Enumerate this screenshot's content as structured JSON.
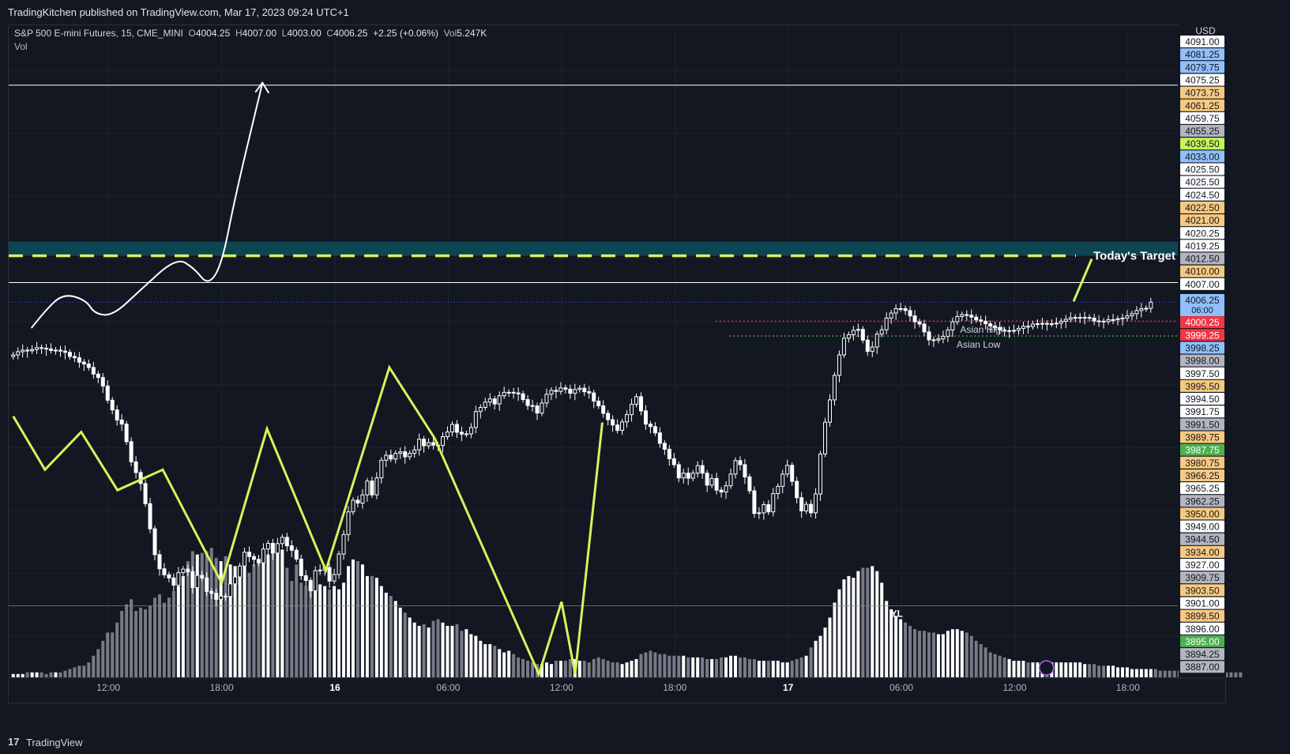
{
  "header": {
    "published": "TradingKitchen published on TradingView.com, Mar 17, 2023 09:24 UTC+1"
  },
  "legend": {
    "symbol": "S&P 500 E-mini Futures, 15, CME_MINI",
    "o_label": "O",
    "o": "4004.25",
    "h_label": "H",
    "h": "4007.00",
    "l_label": "L",
    "l": "4003.00",
    "c_label": "C",
    "c": "4006.25",
    "change": "+2.25 (+0.06%)",
    "vol_label": "Vol",
    "vol": "5.247K",
    "study": "Vol"
  },
  "footer": {
    "brand": "TradingView",
    "logo": "17"
  },
  "colors": {
    "background": "#131722",
    "candle": "#ffffff",
    "volume_up": "#ffffff",
    "volume_down": "#787b86",
    "target_line": "#d4f55a",
    "target_zone": "#0e4d5a",
    "path_yellow": "#d4f55a",
    "asian_high": "#f23645",
    "asian_low": "#4caf50",
    "yl": "#4caf50"
  },
  "chart_data": {
    "type": "candlestick",
    "currency": "USD",
    "ylim": [
      3887.0,
      4091.0
    ],
    "x_time_axis": [
      {
        "label": "12:00",
        "t": 0.5
      },
      {
        "label": "18:00",
        "t": 0.75
      },
      {
        "label": "16",
        "t": 1.0,
        "bold": true
      },
      {
        "label": "06:00",
        "t": 1.25
      },
      {
        "label": "12:00",
        "t": 1.5
      },
      {
        "label": "18:00",
        "t": 1.75
      },
      {
        "label": "17",
        "t": 2.0,
        "bold": true
      },
      {
        "label": "06:00",
        "t": 2.25
      },
      {
        "label": "12:00",
        "t": 2.5
      },
      {
        "label": "18:00",
        "t": 2.75
      }
    ],
    "xlim_days": [
      0.28,
      2.86
    ],
    "price_scale": [
      {
        "value": "4091.00",
        "bg": "#ffffff",
        "fg": "#131722",
        "partial": true
      },
      {
        "value": "4081.25",
        "bg": "#90bff9",
        "fg": "#131722"
      },
      {
        "value": "4079.75",
        "bg": "#90bff9",
        "fg": "#131722"
      },
      {
        "value": "4075.25",
        "bg": "#ffffff",
        "fg": "#131722"
      },
      {
        "value": "4073.75",
        "bg": "#f7c980",
        "fg": "#131722"
      },
      {
        "value": "4061.25",
        "bg": "#f7c980",
        "fg": "#131722"
      },
      {
        "value": "4059.75",
        "bg": "#ffffff",
        "fg": "#131722"
      },
      {
        "value": "4055.25",
        "bg": "#b2b5be",
        "fg": "#131722"
      },
      {
        "value": "4039.50",
        "bg": "#c1f655",
        "fg": "#131722"
      },
      {
        "value": "4033.00",
        "bg": "#90bff9",
        "fg": "#131722"
      },
      {
        "value": "4025.50",
        "bg": "#ffffff",
        "fg": "#131722"
      },
      {
        "value": "4025.50",
        "bg": "#ffffff",
        "fg": "#131722"
      },
      {
        "value": "4024.50",
        "bg": "#ffffff",
        "fg": "#131722"
      },
      {
        "value": "4022.50",
        "bg": "#f7c980",
        "fg": "#131722"
      },
      {
        "value": "4021.00",
        "bg": "#f7c980",
        "fg": "#131722"
      },
      {
        "value": "4020.25",
        "bg": "#ffffff",
        "fg": "#131722"
      },
      {
        "value": "4019.25",
        "bg": "#ffffff",
        "fg": "#131722"
      },
      {
        "value": "4012.50",
        "bg": "#b2b5be",
        "fg": "#131722"
      },
      {
        "value": "4010.00",
        "bg": "#f7c980",
        "fg": "#131722"
      },
      {
        "value": "4007.00",
        "bg": "#ffffff",
        "fg": "#131722"
      },
      {
        "value": "4006.25",
        "bg": "#90bff9",
        "fg": "#131722",
        "sub": "06:00",
        "tall": true
      },
      {
        "value": "4000.25",
        "bg": "#f23645",
        "fg": "#ffffff"
      },
      {
        "value": "3999.25",
        "bg": "#f23645",
        "fg": "#ffffff"
      },
      {
        "value": "3998.25",
        "bg": "#90bff9",
        "fg": "#131722"
      },
      {
        "value": "3998.00",
        "bg": "#b2b5be",
        "fg": "#131722"
      },
      {
        "value": "3997.50",
        "bg": "#ffffff",
        "fg": "#131722"
      },
      {
        "value": "3995.50",
        "bg": "#f7c980",
        "fg": "#131722"
      },
      {
        "value": "3994.50",
        "bg": "#ffffff",
        "fg": "#131722"
      },
      {
        "value": "3991.75",
        "bg": "#ffffff",
        "fg": "#131722"
      },
      {
        "value": "3991.50",
        "bg": "#b2b5be",
        "fg": "#131722"
      },
      {
        "value": "3989.75",
        "bg": "#f7c980",
        "fg": "#131722"
      },
      {
        "value": "3987.75",
        "bg": "#4caf50",
        "fg": "#ffffff"
      },
      {
        "value": "3980.75",
        "bg": "#f7c980",
        "fg": "#131722"
      },
      {
        "value": "3966.25",
        "bg": "#f7c980",
        "fg": "#131722"
      },
      {
        "value": "3965.25",
        "bg": "#ffffff",
        "fg": "#131722"
      },
      {
        "value": "3962.25",
        "bg": "#b2b5be",
        "fg": "#131722"
      },
      {
        "value": "3950.00",
        "bg": "#f7c980",
        "fg": "#131722"
      },
      {
        "value": "3949.00",
        "bg": "#ffffff",
        "fg": "#131722"
      },
      {
        "value": "3944.50",
        "bg": "#b2b5be",
        "fg": "#131722"
      },
      {
        "value": "3934.00",
        "bg": "#f7c980",
        "fg": "#131722"
      },
      {
        "value": "3927.00",
        "bg": "#ffffff",
        "fg": "#131722"
      },
      {
        "value": "3909.75",
        "bg": "#b2b5be",
        "fg": "#131722"
      },
      {
        "value": "3903.50",
        "bg": "#f7c980",
        "fg": "#131722"
      },
      {
        "value": "3901.00",
        "bg": "#ffffff",
        "fg": "#131722"
      },
      {
        "value": "3899.50",
        "bg": "#f7c980",
        "fg": "#131722"
      },
      {
        "value": "3896.00",
        "bg": "#ffffff",
        "fg": "#131722"
      },
      {
        "value": "3895.00",
        "bg": "#4caf50",
        "fg": "#ffffff"
      },
      {
        "value": "3894.25",
        "bg": "#b2b5be",
        "fg": "#131722"
      },
      {
        "value": "3887.00",
        "bg": "#b2b5be",
        "fg": "#131722"
      }
    ],
    "close_series": {
      "start_t": 0.29,
      "interval_days": 0.0104167,
      "closes": [
        3989.5,
        3990.5,
        3991.0,
        3990.8,
        3991.2,
        3991.8,
        3991.6,
        3991.4,
        3990.9,
        3991.0,
        3990.7,
        3990.3,
        3989.0,
        3988.6,
        3987.2,
        3986.6,
        3985.5,
        3983.4,
        3982.3,
        3979.6,
        3975.1,
        3972.0,
        3968.8,
        3967.5,
        3961.9,
        3955.5,
        3952.1,
        3948.6,
        3942.2,
        3934.2,
        3926.0,
        3921.5,
        3919.6,
        3918.6,
        3916.3,
        3920.3,
        3921.4,
        3920.6,
        3915.5,
        3919.4,
        3918.6,
        3914.3,
        3913.7,
        3911.8,
        3912.8,
        3912.7,
        3916.7,
        3918.9,
        3922.4,
        3926.8,
        3925.4,
        3924.5,
        3923.4,
        3927.8,
        3929.6,
        3926.5,
        3929.5,
        3931.5,
        3928.8,
        3927.4,
        3924.6,
        3919.3,
        3917.8,
        3914.5,
        3920.9,
        3921.1,
        3921.9,
        3917.6,
        3919.7,
        3926.2,
        3932.4,
        3939.6,
        3943.3,
        3942.4,
        3945.0,
        3949.4,
        3945.0,
        3950.4,
        3956.0,
        3957.6,
        3956.4,
        3958.2,
        3958.7,
        3957.1,
        3958.2,
        3959.3,
        3962.7,
        3960.6,
        3961.6,
        3960.8,
        3960.7,
        3963.5,
        3965.0,
        3967.4,
        3964.9,
        3964.3,
        3964.4,
        3966.4,
        3971.5,
        3972.8,
        3974.5,
        3975.5,
        3973.9,
        3976.5,
        3977.6,
        3977.6,
        3977.4,
        3977.1,
        3975.3,
        3973.4,
        3973.3,
        3971.0,
        3974.2,
        3977.0,
        3978.2,
        3977.9,
        3979.0,
        3978.6,
        3977.3,
        3978.5,
        3978.9,
        3977.8,
        3977.4,
        3974.8,
        3973.3,
        3970.9,
        3968.9,
        3967.2,
        3965.5,
        3968.2,
        3970.5,
        3973.8,
        3976.2,
        3971.7,
        3967.5,
        3966.7,
        3964.7,
        3961.4,
        3959.5,
        3956.5,
        3954.6,
        3950.4,
        3951.9,
        3950.3,
        3951.9,
        3954.3,
        3951.9,
        3948.1,
        3950.2,
        3946.5,
        3945.9,
        3947.9,
        3951.6,
        3955.9,
        3954.6,
        3950.7,
        3946.3,
        3939.1,
        3939.3,
        3941.9,
        3939.6,
        3945.4,
        3947.7,
        3951.6,
        3954.4,
        3949.3,
        3944.1,
        3939.9,
        3942.0,
        3939.3,
        3945.3,
        3958.0,
        3968.1,
        3975.2,
        3983.0,
        3989.5,
        3994.8,
        3995.9,
        3997.3,
        3997.6,
        3994.2,
        3990.6,
        3992.0,
        3996.1,
        3997.5,
        4001.2,
        4002.8,
        4004.2,
        4004.2,
        4003.6,
        4001.9,
        4000.0,
        3999.3,
        3996.8,
        3994.3,
        3994.2,
        3994.6,
        3995.4,
        3997.4,
        4000.0,
        4001.7,
        4002.3,
        4002.1,
        4001.5,
        4000.6,
        4000.2,
        3999.4,
        3998.7,
        3998.2,
        3997.4,
        3997.1,
        3997.2,
        3997.3,
        3997.9,
        3998.6,
        3998.5,
        3999.3,
        3999.4,
        3999.5,
        3999.4,
        3999.4,
        3999.6,
        4000.2,
        4000.8,
        4001.3,
        4001.4,
        4001.4,
        4001.4,
        4001.2,
        4000.3,
        4000.2,
        4000.1,
        4000.7,
        4000.7,
        4001.0,
        4001.2,
        4001.9,
        4002.6,
        4003.6,
        4004.2,
        4004.3,
        4006.25
      ]
    },
    "volume_series": [
      2,
      2,
      2,
      3,
      3,
      3,
      3,
      2,
      3,
      3,
      3,
      4,
      5,
      6,
      7,
      7,
      9,
      13,
      17,
      22,
      27,
      27,
      33,
      40,
      44,
      47,
      40,
      42,
      41,
      43,
      48,
      50,
      45,
      48,
      52,
      55,
      61,
      70,
      76,
      74,
      75,
      76,
      78,
      72,
      70,
      73,
      68,
      67,
      67,
      68,
      63,
      68,
      70,
      73,
      74,
      80,
      79,
      77,
      66,
      58,
      68,
      57,
      55,
      54,
      55,
      56,
      55,
      53,
      55,
      53,
      57,
      67,
      71,
      70,
      68,
      61,
      61,
      60,
      55,
      51,
      49,
      46,
      42,
      39,
      36,
      33,
      31,
      32,
      30,
      34,
      35,
      33,
      31,
      31,
      32,
      28,
      29,
      26,
      25,
      22,
      20,
      20,
      19,
      17,
      15,
      16,
      14,
      12,
      11,
      10,
      9,
      8,
      8,
      9,
      8,
      10,
      10,
      10,
      11,
      11,
      10,
      10,
      9,
      11,
      12,
      11,
      10,
      9,
      9,
      8,
      9,
      10,
      11,
      14,
      15,
      16,
      15,
      14,
      14,
      13,
      13,
      13,
      13,
      12,
      12,
      12,
      12,
      11,
      11,
      11,
      12,
      12,
      13,
      13,
      12,
      12,
      11,
      11,
      10,
      10,
      10,
      10,
      10,
      9,
      9,
      10,
      11,
      12,
      13,
      18,
      22,
      25,
      30,
      36,
      45,
      53,
      59,
      61,
      60,
      64,
      66,
      66,
      67,
      64,
      57,
      46,
      41,
      37,
      35,
      33,
      31,
      29,
      28,
      28,
      27,
      27,
      26,
      26,
      28,
      29,
      29,
      28,
      27,
      25,
      22,
      20,
      18,
      15,
      14,
      13,
      12,
      11,
      10,
      10,
      10,
      9,
      9,
      9,
      9,
      9,
      9,
      9,
      9,
      9,
      9,
      9,
      9,
      8,
      8,
      8,
      7,
      7,
      7,
      7,
      6,
      6,
      6,
      5,
      5,
      5,
      5,
      5,
      5,
      4,
      4,
      4,
      4,
      4,
      4,
      3,
      3,
      3,
      3,
      3,
      3,
      3,
      3,
      3,
      3,
      3,
      3
    ],
    "volume_max": 100,
    "levels": [
      {
        "price": 4075.25,
        "style": "solid",
        "color": "#ffffff"
      },
      {
        "price": 4012.5,
        "style": "solid",
        "color": "#ffffff"
      },
      {
        "price": 4006.25,
        "style": "dotted",
        "color": "#2962ff"
      }
    ],
    "target": {
      "price": 4021.0,
      "label": "Today's Target",
      "zone": [
        4021.0,
        4025.5
      ]
    },
    "asian_high": {
      "price": 4000.25,
      "label": "Asian High",
      "from_t": 1.84
    },
    "asian_low": {
      "price": 3995.5,
      "label": "Asian Low",
      "from_t": 1.87
    },
    "yl": {
      "price": 3909.75,
      "label": "YL"
    },
    "white_path": [
      [
        0.33,
        3998.0
      ],
      [
        0.36,
        4003.5
      ],
      [
        0.4,
        4009.0
      ],
      [
        0.45,
        4007.0
      ],
      [
        0.47,
        4002.5
      ],
      [
        0.51,
        4002.0
      ],
      [
        0.57,
        4010.0
      ],
      [
        0.65,
        4020.5
      ],
      [
        0.69,
        4017.0
      ],
      [
        0.72,
        4011.5
      ],
      [
        0.75,
        4018.0
      ],
      [
        0.78,
        4040.0
      ],
      [
        0.84,
        4076.0
      ]
    ],
    "yellow_path": [
      [
        0.29,
        3970.0
      ],
      [
        0.36,
        3953.0
      ],
      [
        0.44,
        3965.0
      ],
      [
        0.52,
        3946.5
      ],
      [
        0.62,
        3953.0
      ],
      [
        0.75,
        3917.0
      ],
      [
        0.85,
        3966.0
      ],
      [
        0.98,
        3921.0
      ],
      [
        1.12,
        3985.5
      ],
      [
        1.22,
        3963.0
      ],
      [
        1.45,
        3888.0
      ],
      [
        1.5,
        3911.0
      ],
      [
        1.53,
        3888.0
      ],
      [
        1.59,
        3968.0
      ]
    ],
    "yellow_short": [
      [
        2.63,
        4006.5
      ],
      [
        2.67,
        4020.0
      ]
    ]
  }
}
